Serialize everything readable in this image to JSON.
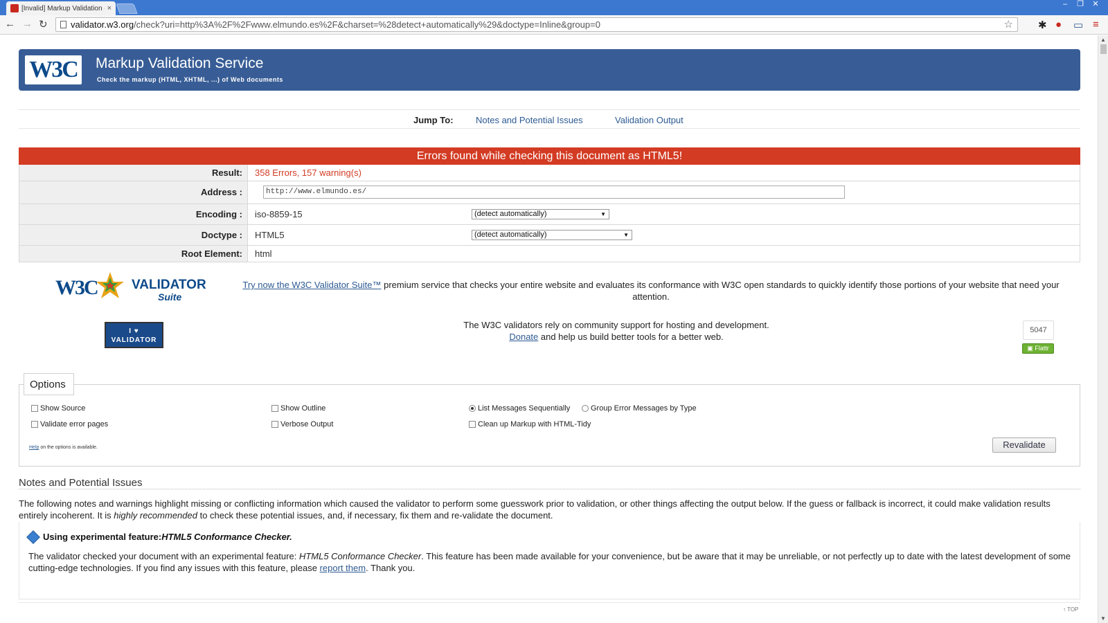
{
  "browser": {
    "tab_title": "[Invalid] Markup Validation o",
    "tab_close": "×",
    "url_host": "validator.w3.org",
    "url_path": "/check?uri=http%3A%2F%2Fwww.elmundo.es%2F&charset=%28detect+automatically%29&doctype=Inline&group=0"
  },
  "banner": {
    "logo": "W3C",
    "title": "Markup Validation Service",
    "subtitle": "Check the markup (HTML, XHTML, ...) of Web documents"
  },
  "jump": {
    "label": "Jump To:",
    "links": [
      "Notes and Potential Issues",
      "Validation Output"
    ]
  },
  "result": {
    "banner": "Errors found while checking this document as HTML5!",
    "result_label": "Result:",
    "result_value": "358 Errors, 157 warning(s)",
    "address_label": "Address :",
    "address_value": "http://www.elmundo.es/",
    "encoding_label": "Encoding :",
    "encoding_value": "iso-8859-15",
    "encoding_select": "(detect automatically)",
    "doctype_label": "Doctype :",
    "doctype_value": "HTML5",
    "doctype_select": "(detect automatically)",
    "root_label": "Root Element:",
    "root_value": "html"
  },
  "suite": {
    "logo_w3c": "W3C",
    "logo_validator": "VALIDATOR",
    "logo_suite": "Suite",
    "link": "Try now the W3C Validator Suite™",
    "text": " premium service that checks your entire website and evaluates its conformance with W3C open standards to quickly identify those portions of your website that need your attention."
  },
  "support": {
    "badge_line1": "I ♥",
    "badge_line2": "VALIDATOR",
    "line1": "The W3C validators rely on community support for hosting and development.",
    "donate": "Donate",
    "line2": " and help us build better tools for a better web.",
    "flattr_count": "5047",
    "flattr_label": "Flattr"
  },
  "options": {
    "legend": "Options",
    "show_source": "Show Source",
    "show_outline": "Show Outline",
    "list_sequential": "List Messages Sequentially",
    "group_by_type": "Group Error Messages by Type",
    "validate_error_pages": "Validate error pages",
    "verbose_output": "Verbose Output",
    "clean_up": "Clean up Markup with HTML-Tidy",
    "help_link": "Help",
    "help_text": " on the options is available.",
    "revalidate": "Revalidate"
  },
  "notes": {
    "heading": "Notes and Potential Issues",
    "text_before": "The following notes and warnings highlight missing or conflicting information which caused the validator to perform some guesswork prior to validation, or other things affecting the output below. If the guess or fallback is incorrect, it could make validation results entirely incoherent. It is ",
    "text_em": "highly recommended",
    "text_after": " to check these potential issues, and, if necessary, fix them and re-validate the document.",
    "note_title_plain": "Using experimental feature: ",
    "note_title_em": "HTML5 Conformance Checker.",
    "note_body_1": "The validator checked your document with an experimental feature: ",
    "note_body_em": "HTML5 Conformance Checker",
    "note_body_2": ". This feature has been made available for your convenience, but be aware that it may be unreliable, or not perfectly up to date with the latest development of some cutting-edge technologies. If you find any issues with this feature, please ",
    "note_link": "report them",
    "note_body_3": ". Thank you.",
    "top_link": "↑ TOP"
  }
}
